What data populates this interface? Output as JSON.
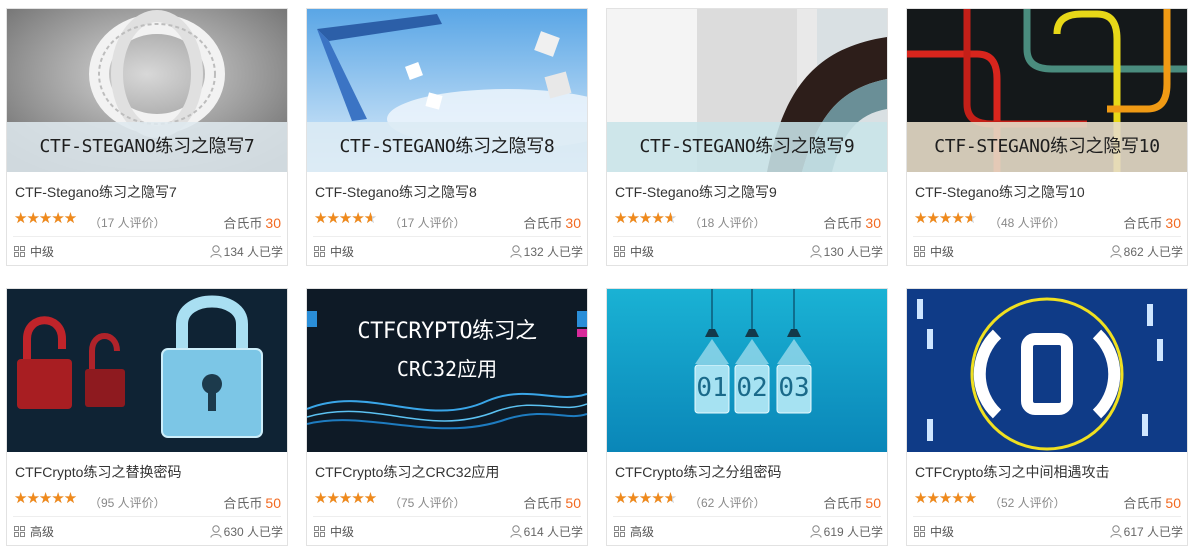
{
  "courses": [
    {
      "banner": "CTF-STEGANO练习之隐写7",
      "title": "CTF-Stegano练习之隐写7",
      "rating": 4.5,
      "reviews": "（17 人评价）",
      "price_label": "合氏币",
      "price": "30",
      "level": "中级",
      "learners": "134 人已学"
    },
    {
      "banner": "CTF-STEGANO练习之隐写8",
      "title": "CTF-Stegano练习之隐写8",
      "rating": 4.0,
      "reviews": "（17 人评价）",
      "price_label": "合氏币",
      "price": "30",
      "level": "中级",
      "learners": "132 人已学"
    },
    {
      "banner": "CTF-STEGANO练习之隐写9",
      "title": "CTF-Stegano练习之隐写9",
      "rating": 4.0,
      "reviews": "（18 人评价）",
      "price_label": "合氏币",
      "price": "30",
      "level": "中级",
      "learners": "130 人已学"
    },
    {
      "banner": "CTF-STEGANO练习之隐写10",
      "title": "CTF-Stegano练习之隐写10",
      "rating": 4.0,
      "reviews": "（48 人评价）",
      "price_label": "合氏币",
      "price": "30",
      "level": "中级",
      "learners": "862 人已学"
    },
    {
      "banner": "",
      "title": "CTFCrypto练习之替换密码",
      "rating": 4.5,
      "reviews": "（95 人评价）",
      "price_label": "合氏币",
      "price": "50",
      "level": "高级",
      "learners": "630 人已学"
    },
    {
      "banner_lines": [
        "CTFCRYPTO练习之",
        "CRC32应用"
      ],
      "title": "CTFCrypto练习之CRC32应用",
      "rating": 4.5,
      "reviews": "（75 人评价）",
      "price_label": "合氏币",
      "price": "50",
      "level": "中级",
      "learners": "614 人已学"
    },
    {
      "badges": [
        "01",
        "02",
        "03"
      ],
      "title": "CTFCrypto练习之分组密码",
      "rating": 4.0,
      "reviews": "（62 人评价）",
      "price_label": "合氏币",
      "price": "50",
      "level": "高级",
      "learners": "619 人已学"
    },
    {
      "banner": "",
      "title": "CTFCrypto练习之中间相遇攻击",
      "rating": 4.5,
      "reviews": "（52 人评价）",
      "price_label": "合氏币",
      "price": "50",
      "level": "中级",
      "learners": "617 人已学"
    }
  ],
  "colors": {
    "star": "#f08a1c",
    "price": "#f26a21"
  },
  "icons": {
    "level": "grid-icon",
    "learners": "user-icon",
    "rating": "star-icon"
  }
}
